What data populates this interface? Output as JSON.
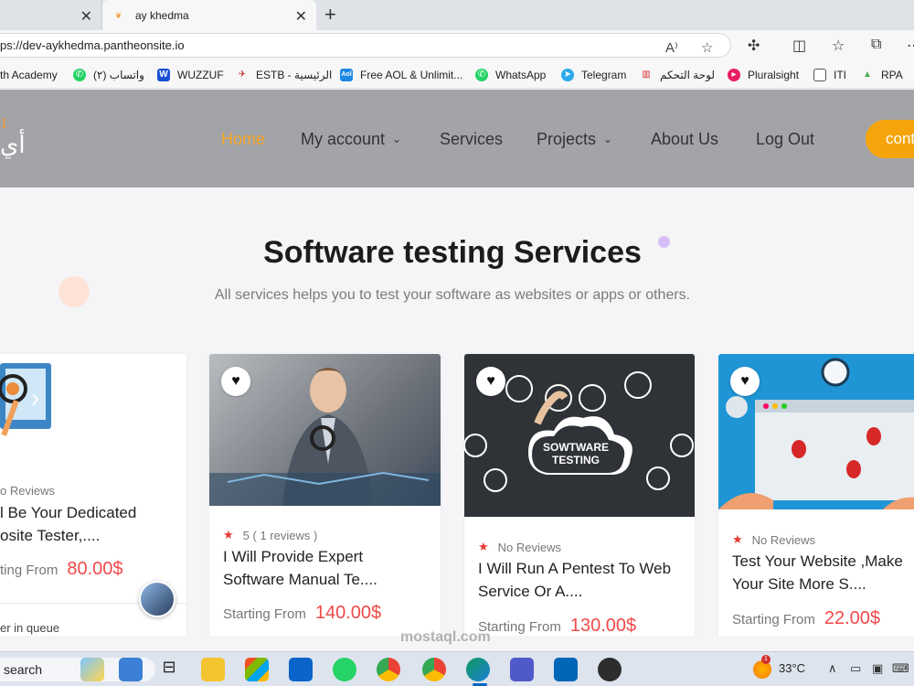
{
  "browser": {
    "tabs": [
      {
        "title": ""
      },
      {
        "title": "ay khedma"
      }
    ],
    "address": "ps://dev-aykhedma.pantheonsite.io",
    "bookmarks": [
      {
        "label": "th Academy",
        "icon": "academy-icon",
        "color": "#1a73e8"
      },
      {
        "label": "واتساب (٢)",
        "icon": "whatsapp-icon",
        "color": "#25d366"
      },
      {
        "label": "WUZZUF",
        "icon": "wuzzuf-icon",
        "color": "#1a4fd6"
      },
      {
        "label": "ESTB - الرئيسية",
        "icon": "estb-icon",
        "color": "#c62828"
      },
      {
        "label": "Free AOL & Unlimit...",
        "icon": "aol-icon",
        "color": "#1e88e5"
      },
      {
        "label": "WhatsApp",
        "icon": "whatsapp-icon",
        "color": "#25d366"
      },
      {
        "label": "Telegram",
        "icon": "telegram-icon",
        "color": "#29a9eb"
      },
      {
        "label": "لوحة التحكم",
        "icon": "dashboard-icon",
        "color": "#d32f2f"
      },
      {
        "label": "Pluralsight",
        "icon": "pluralsight-icon",
        "color": "#e91e63"
      },
      {
        "label": "ITI",
        "icon": "document-icon",
        "color": "#ffffff"
      },
      {
        "label": "RPA",
        "icon": "rpa-icon",
        "color": "#4caf50"
      }
    ]
  },
  "site": {
    "nav": [
      {
        "label": "Home",
        "active": true
      },
      {
        "label": "My account",
        "dropdown": true
      },
      {
        "label": "Services"
      },
      {
        "label": "Projects",
        "dropdown": true
      },
      {
        "label": "About Us"
      },
      {
        "label": "Log Out"
      }
    ],
    "contact_label": "cont",
    "accent": "#f5a524"
  },
  "section": {
    "title": "Software testing Services",
    "subtitle": "All services helps you to test your software as websites or apps or others."
  },
  "cards": [
    {
      "rating": "o Reviews",
      "title_line1": "l Be Your Dedicated",
      "title_line2": "osite Tester,....",
      "price_label": "ting From",
      "price": "80.00$",
      "queue": "er in queue"
    },
    {
      "rating": "5 ( 1 reviews )",
      "title_line1": "I Will Provide Expert",
      "title_line2": "Software Manual Te....",
      "price_label": "Starting From",
      "price": "140.00$"
    },
    {
      "rating": "No Reviews",
      "title_line1": "I Will Run A Pentest To Web",
      "title_line2": "Service Or A....",
      "price_label": "Starting From",
      "price": "130.00$",
      "image_text_1": "SOWTWARE",
      "image_text_2": "TESTING"
    },
    {
      "rating": "No Reviews",
      "title_line1": "Test Your Website ,Make",
      "title_line2": "Your Site More S....",
      "price_label": "Starting From",
      "price": "22.00$"
    }
  ],
  "taskbar": {
    "search": "search",
    "temperature": "33°C",
    "badge": "1",
    "watermark": "mostaql.com"
  }
}
